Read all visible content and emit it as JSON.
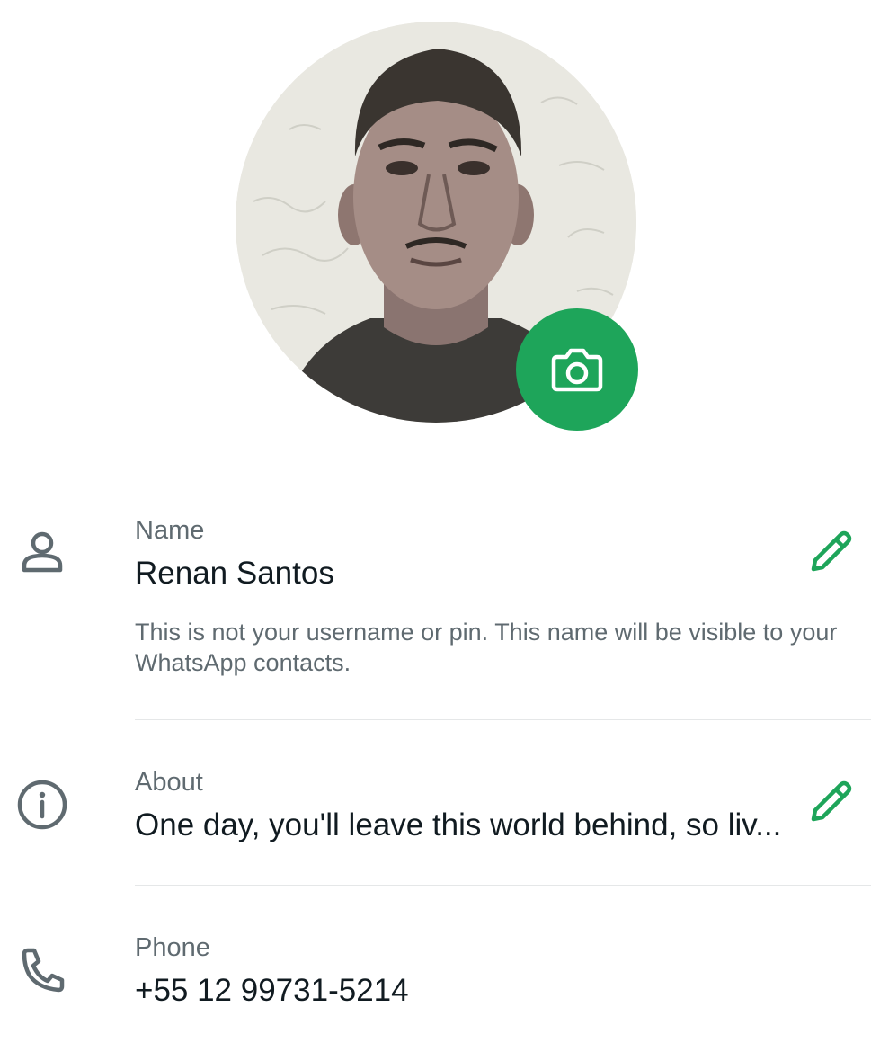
{
  "profile": {
    "photo_icon": "profile-photo",
    "camera_icon": "camera-icon",
    "accent_color": "#1ea55a"
  },
  "name_row": {
    "icon": "person-icon",
    "label": "Name",
    "value": "Renan Santos",
    "help": "This is not your username or pin. This name will be visible to your WhatsApp contacts.",
    "edit_icon": "pencil-icon"
  },
  "about_row": {
    "icon": "info-icon",
    "label": "About",
    "value": "One day, you'll leave this world behind, so liv...",
    "edit_icon": "pencil-icon"
  },
  "phone_row": {
    "icon": "phone-icon",
    "label": "Phone",
    "value": "+55 12 99731-5214"
  }
}
